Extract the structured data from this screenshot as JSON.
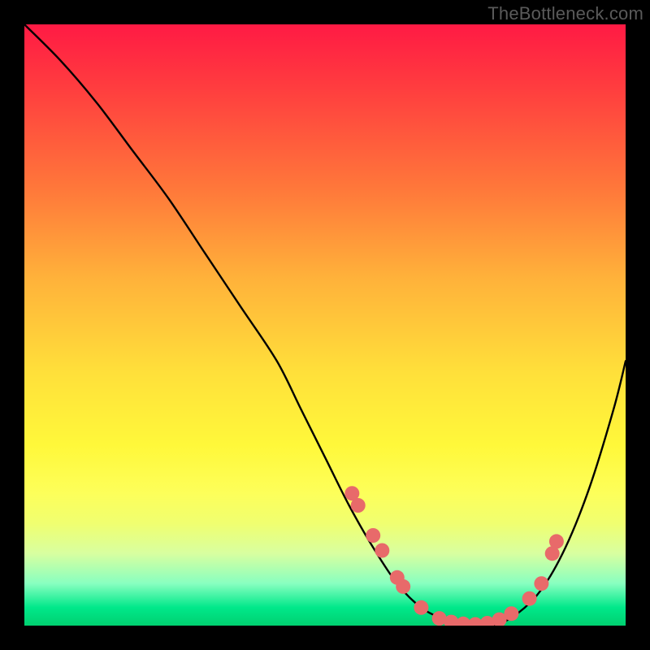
{
  "watermark": "TheBottleneck.com",
  "chart_data": {
    "type": "line",
    "title": "",
    "xlabel": "",
    "ylabel": "",
    "xlim": [
      0,
      100
    ],
    "ylim": [
      0,
      100
    ],
    "series": [
      {
        "name": "bottleneck-curve",
        "x": [
          0,
          6,
          12,
          18,
          24,
          30,
          36,
          42,
          46,
          50,
          54,
          58,
          62,
          66,
          70,
          74,
          78,
          82,
          86,
          90,
          94,
          98,
          100
        ],
        "y": [
          100,
          94,
          87,
          79,
          71,
          62,
          53,
          44,
          36,
          28,
          20,
          13,
          7,
          3,
          1,
          0,
          0,
          2,
          6,
          13,
          23,
          36,
          44
        ]
      }
    ],
    "markers": {
      "name": "highlight-points",
      "color": "#e86a6a",
      "radius": 9,
      "points": [
        {
          "x": 54.5,
          "y": 22
        },
        {
          "x": 55.5,
          "y": 20
        },
        {
          "x": 58,
          "y": 15
        },
        {
          "x": 59.5,
          "y": 12.5
        },
        {
          "x": 62,
          "y": 8
        },
        {
          "x": 63,
          "y": 6.5
        },
        {
          "x": 66,
          "y": 3
        },
        {
          "x": 69,
          "y": 1.2
        },
        {
          "x": 71,
          "y": 0.6
        },
        {
          "x": 73,
          "y": 0.3
        },
        {
          "x": 75,
          "y": 0.2
        },
        {
          "x": 77,
          "y": 0.4
        },
        {
          "x": 79,
          "y": 1
        },
        {
          "x": 81,
          "y": 2
        },
        {
          "x": 84,
          "y": 4.5
        },
        {
          "x": 86,
          "y": 7
        },
        {
          "x": 87.8,
          "y": 12
        },
        {
          "x": 88.5,
          "y": 14
        }
      ]
    }
  }
}
